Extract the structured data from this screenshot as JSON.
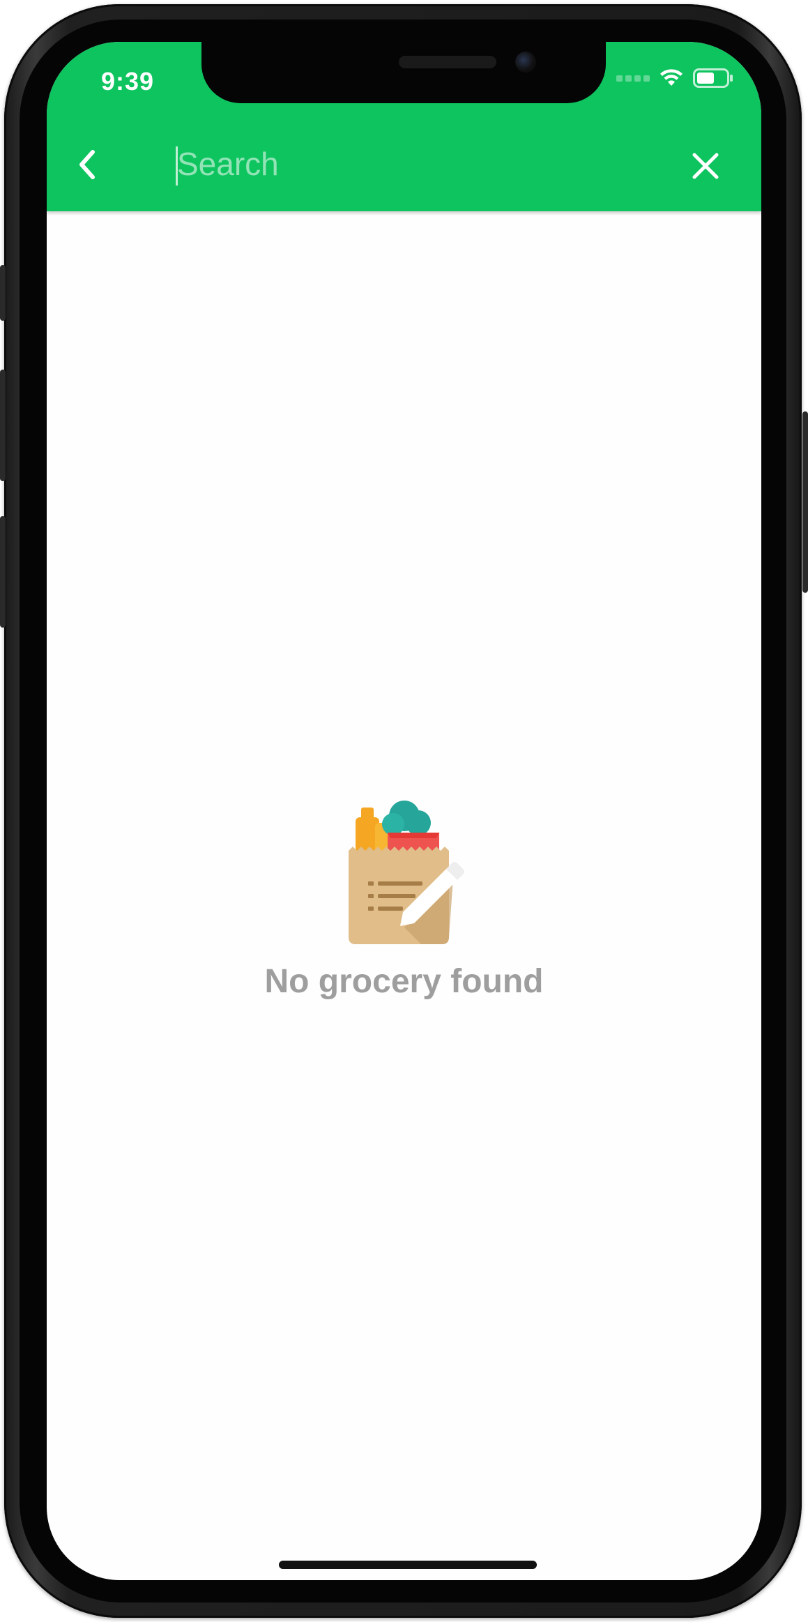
{
  "status_bar": {
    "time": "9:39"
  },
  "app_bar": {
    "background_color": "#0ec45f",
    "back_icon": "chevron-left-icon",
    "close_icon": "close-icon"
  },
  "search": {
    "placeholder": "Search",
    "value": ""
  },
  "empty_state": {
    "illustration": "grocery-bag-list-icon",
    "message": "No grocery found"
  }
}
